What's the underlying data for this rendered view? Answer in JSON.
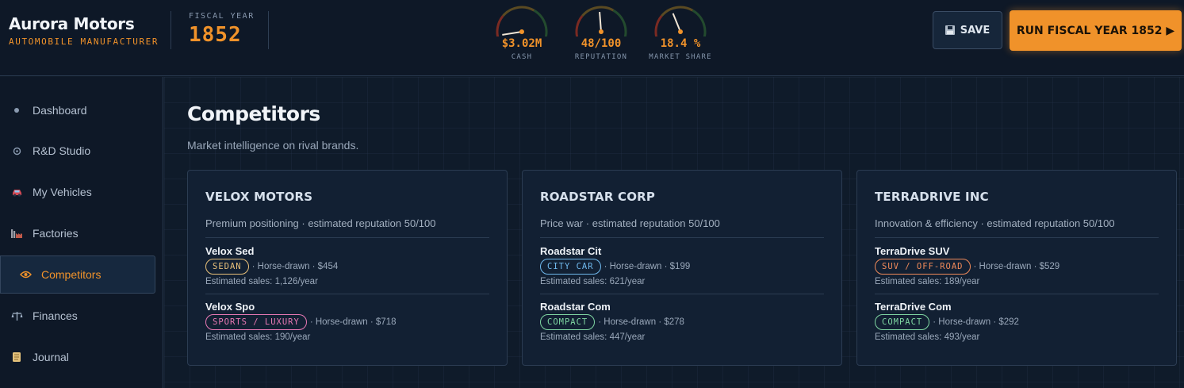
{
  "brand": {
    "name": "Aurora Motors",
    "subtitle": "AUTOMOBILE MANUFACTURER"
  },
  "fiscal": {
    "label": "FISCAL YEAR",
    "year": "1852"
  },
  "gauges": [
    {
      "value": "$3.02M",
      "label": "CASH",
      "level": 0.05
    },
    {
      "value": "48/100",
      "label": "REPUTATION",
      "level": 0.48
    },
    {
      "value": "18.4 %",
      "label": "MARKET SHARE",
      "level": 0.4
    }
  ],
  "toolbar": {
    "save_label": "SAVE",
    "run_label": "RUN FISCAL YEAR 1852 ▶"
  },
  "sidebar": {
    "items": [
      {
        "label": "Dashboard",
        "icon": "dot-icon",
        "active": false
      },
      {
        "label": "R&D Studio",
        "icon": "gear-icon",
        "active": false
      },
      {
        "label": "My Vehicles",
        "icon": "car-icon",
        "active": false
      },
      {
        "label": "Factories",
        "icon": "factory-icon",
        "active": false
      },
      {
        "label": "Competitors",
        "icon": "eye-icon",
        "active": true
      },
      {
        "label": "Finances",
        "icon": "scales-icon",
        "active": false
      },
      {
        "label": "Journal",
        "icon": "scroll-icon",
        "active": false
      }
    ]
  },
  "page": {
    "title": "Competitors",
    "subtitle": "Market intelligence on rival brands."
  },
  "colors": {
    "accent": "#f0922a",
    "sedan": "#e8c07a",
    "sports_luxury": "#e879b4",
    "city_car": "#6fb8ec",
    "suv_offroad": "#f08a5a",
    "compact": "#7fd6a2"
  },
  "competitors": [
    {
      "name": "VELOX MOTORS",
      "desc": "Premium positioning · estimated reputation 50/100",
      "vehicles": [
        {
          "name": "Velox Sed",
          "segment": "SEDAN",
          "segment_color": "#e8c07a",
          "details": "· Horse-drawn · $454",
          "sales": "Estimated sales: 1,126/year"
        },
        {
          "name": "Velox Spo",
          "segment": "SPORTS / LUXURY",
          "segment_color": "#e879b4",
          "details": "· Horse-drawn · $718",
          "sales": "Estimated sales: 190/year"
        }
      ]
    },
    {
      "name": "ROADSTAR CORP",
      "desc": "Price war · estimated reputation 50/100",
      "vehicles": [
        {
          "name": "Roadstar Cit",
          "segment": "CITY CAR",
          "segment_color": "#6fb8ec",
          "details": "· Horse-drawn · $199",
          "sales": "Estimated sales: 621/year"
        },
        {
          "name": "Roadstar Com",
          "segment": "COMPACT",
          "segment_color": "#7fd6a2",
          "details": "· Horse-drawn · $278",
          "sales": "Estimated sales: 447/year"
        }
      ]
    },
    {
      "name": "TERRADRIVE INC",
      "desc": "Innovation & efficiency · estimated reputation 50/100",
      "vehicles": [
        {
          "name": "TerraDrive SUV",
          "segment": "SUV / OFF-ROAD",
          "segment_color": "#f08a5a",
          "details": "· Horse-drawn · $529",
          "sales": "Estimated sales: 189/year"
        },
        {
          "name": "TerraDrive Com",
          "segment": "COMPACT",
          "segment_color": "#7fd6a2",
          "details": "· Horse-drawn · $292",
          "sales": "Estimated sales: 493/year"
        }
      ]
    }
  ]
}
